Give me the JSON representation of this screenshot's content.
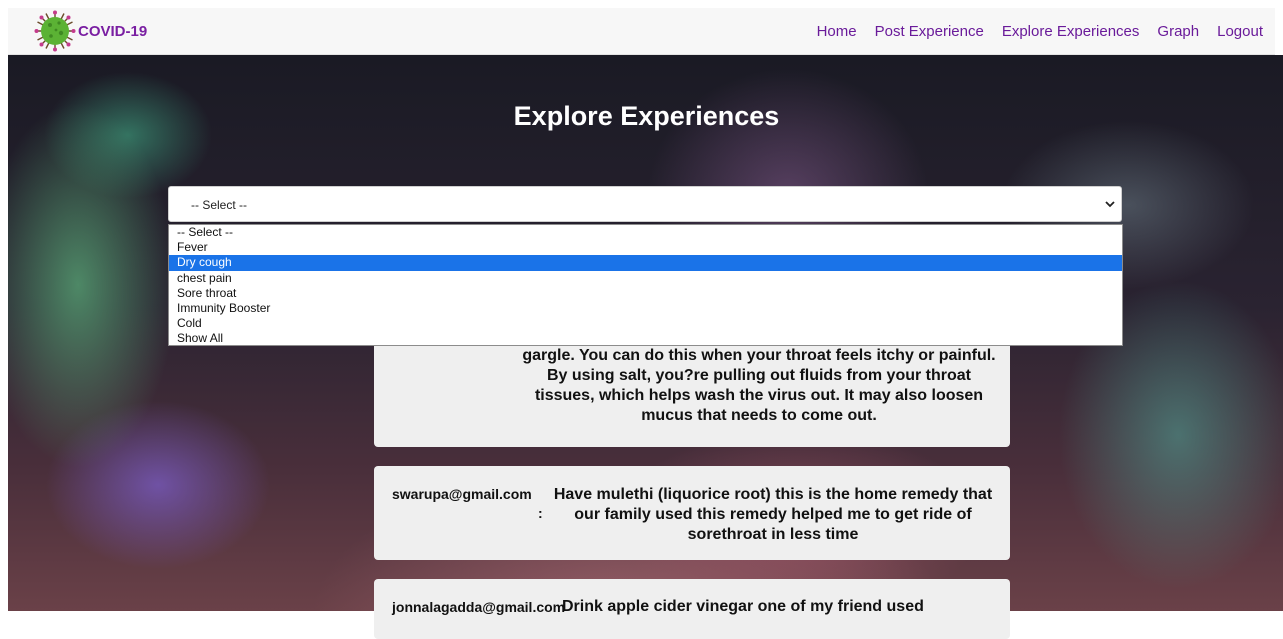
{
  "brand": {
    "name": "COVID-19",
    "logo_icon": "virus-icon"
  },
  "nav": {
    "items": [
      "Home",
      "Post Experience",
      "Explore Experiences",
      "Graph",
      "Logout"
    ]
  },
  "page": {
    "title": "Explore Experiences"
  },
  "filter": {
    "selected": "-- Select --",
    "options": [
      "-- Select --",
      "Fever",
      "Dry cough",
      "chest pain",
      "Sore throat",
      "Immunity Booster",
      "Cold",
      "Show All"
    ],
    "highlighted": "Dry cough"
  },
  "experiences": [
    {
      "email": "",
      "text": "gargle. You can do this when your throat feels itchy or painful. By using salt, you?re pulling out fluids from your throat tissues, which helps wash the virus out. It may also loosen mucus that needs to come out."
    },
    {
      "email": "swarupa@gmail.com",
      "text": "Have mulethi (liquorice root) this is the home remedy that our family used this remedy helped me to get ride of sorethroat in less time"
    },
    {
      "email": "jonnalagadda@gmail.com",
      "text": "Drink apple cider vinegar one of my friend used"
    }
  ],
  "colors": {
    "brand": "#7a1fa2",
    "nav_link": "#6a1b9a",
    "highlight": "#1a73e8",
    "card_bg": "#efefef"
  }
}
